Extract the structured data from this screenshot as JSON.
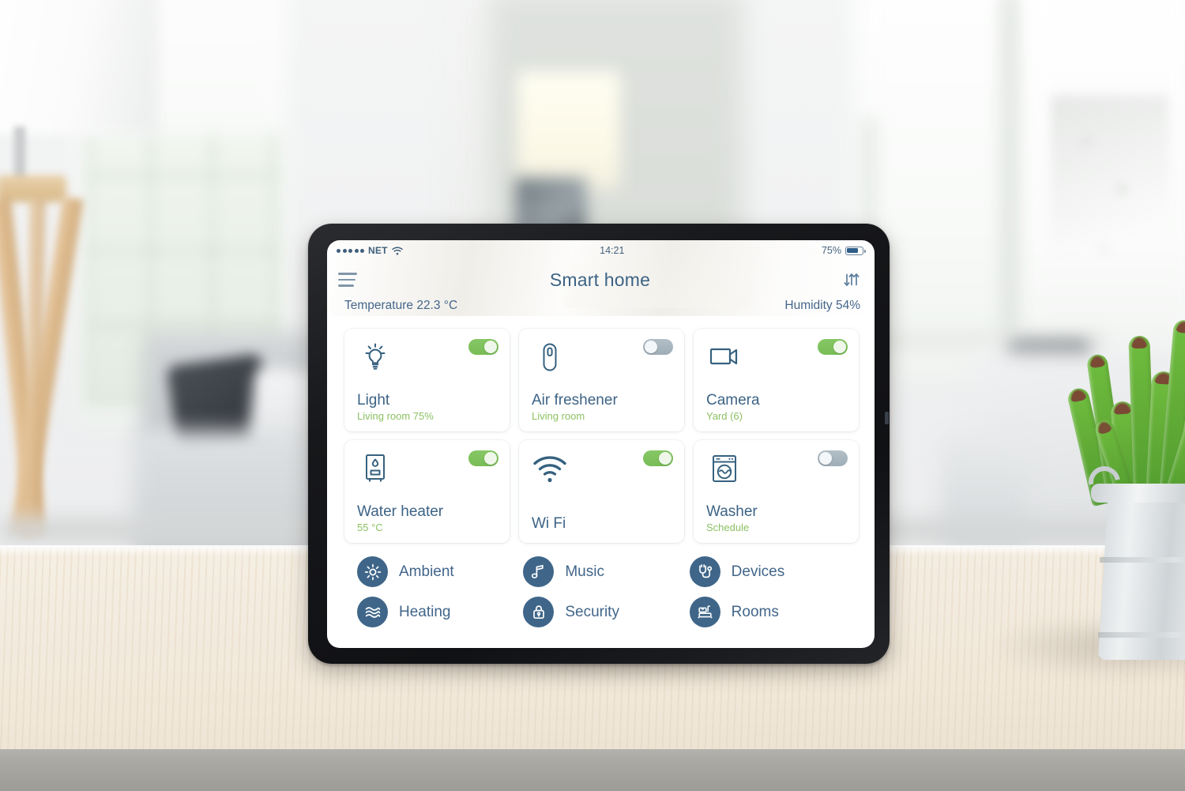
{
  "status_bar": {
    "signal_dots": 5,
    "carrier": "NET",
    "wifi_icon": "wifi-icon",
    "time": "14:21",
    "battery_percent": "75%",
    "battery_level": 75,
    "battery_icon": "battery-icon"
  },
  "header": {
    "menu_icon": "hamburger-menu-icon",
    "title": "Smart home",
    "settings_icon": "sliders-icon"
  },
  "sensors": {
    "temperature": "Temperature 22.3 °C",
    "humidity": "Humidity 54%"
  },
  "colors": {
    "title_blue": "#3c6385",
    "subtitle_green": "#8cc163",
    "toggle_on": "#7ec05b",
    "toggle_off": "#a8b5bf",
    "menu_circle": "#3f6689",
    "icon_blue": "#36617f"
  },
  "cards": [
    {
      "icon": "lightbulb-icon",
      "title": "Light",
      "subtitle": "Living room 75%",
      "toggle": "on"
    },
    {
      "icon": "air-freshener-icon",
      "title": "Air freshener",
      "subtitle": "Living room",
      "toggle": "off"
    },
    {
      "icon": "video-camera-icon",
      "title": "Camera",
      "subtitle": "Yard (6)",
      "toggle": "on"
    },
    {
      "icon": "water-heater-icon",
      "title": "Water heater",
      "subtitle": "55 °C",
      "toggle": "on"
    },
    {
      "icon": "wifi-signal-icon",
      "title": "Wi Fi",
      "subtitle": "",
      "toggle": "on"
    },
    {
      "icon": "washing-machine-icon",
      "title": "Washer",
      "subtitle": "Schedule",
      "toggle": "off"
    }
  ],
  "menu_items": [
    {
      "icon": "sun-icon",
      "label": "Ambient"
    },
    {
      "icon": "music-note-icon",
      "label": "Music"
    },
    {
      "icon": "plug-icon",
      "label": "Devices"
    },
    {
      "icon": "waves-icon",
      "label": "Heating"
    },
    {
      "icon": "lock-icon",
      "label": "Security"
    },
    {
      "icon": "building-icon",
      "label": "Rooms"
    }
  ]
}
